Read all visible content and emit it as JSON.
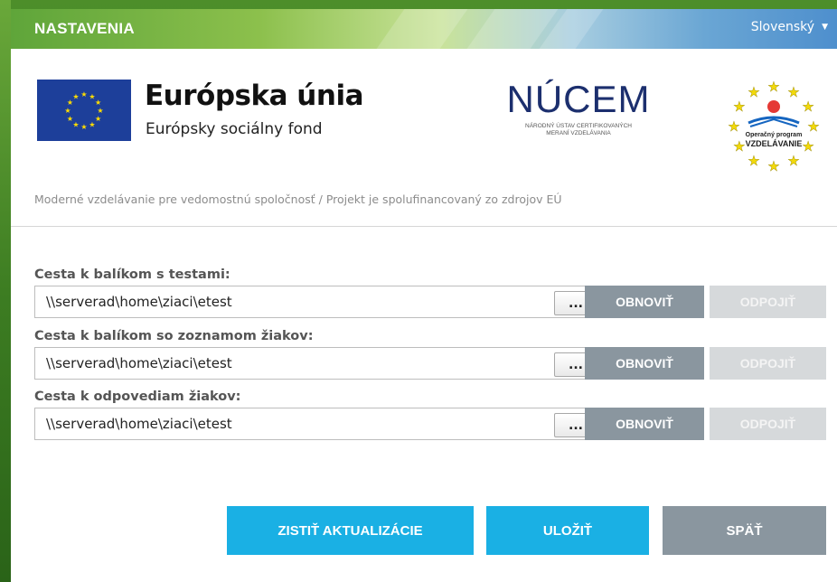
{
  "window": {
    "title": "NASTAVENIA",
    "language": "Slovenský"
  },
  "logos": {
    "eu_title": "Európska únia",
    "eu_subtitle": "Európsky sociálny fond",
    "nucem_name": "NÚCEM",
    "nucem_line1": "NÁRODNÝ ÚSTAV CERTIFIKOVANÝCH",
    "nucem_line2": "MERANÍ VZDELÁVANIA",
    "op_line1": "Operačný program",
    "op_line2": "VZDELÁVANIE"
  },
  "tagline": "Moderné vzdelávanie pre vedomostnú spoločnosť  /  Projekt je spolufinancovaný zo zdrojov EÚ",
  "paths": [
    {
      "label": "Cesta k balíkom s testami:",
      "value": "\\\\serverad\\home\\ziaci\\etest",
      "browse": "...",
      "refresh": "OBNOVIŤ",
      "disconnect": "ODPOJIŤ"
    },
    {
      "label": "Cesta k balíkom so zoznamom žiakov:",
      "value": "\\\\serverad\\home\\ziaci\\etest",
      "browse": "...",
      "refresh": "OBNOVIŤ",
      "disconnect": "ODPOJIŤ"
    },
    {
      "label": "Cesta k odpovediam žiakov:",
      "value": "\\\\serverad\\home\\ziaci\\etest",
      "browse": "...",
      "refresh": "OBNOVIŤ",
      "disconnect": "ODPOJIŤ"
    }
  ],
  "actions": {
    "check_updates": "ZISTIŤ AKTUALIZÁCIE",
    "save": "ULOŽIŤ",
    "back": "SPÄŤ"
  },
  "colors": {
    "accent_blue": "#1ab0e4",
    "button_gray": "#8a969f",
    "disabled_gray": "#d6d9db",
    "eu_blue": "#1d3f9a",
    "eu_star": "#ffdd00"
  },
  "icons": {
    "language_caret": "triangle-down"
  }
}
